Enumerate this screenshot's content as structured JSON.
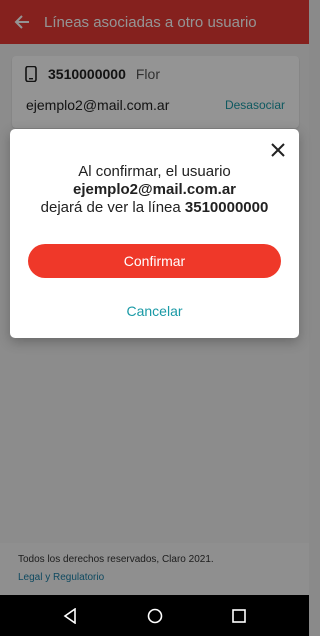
{
  "header": {
    "title": "Líneas asociadas a otro usuario"
  },
  "card": {
    "line_number": "3510000000",
    "line_name": "Flor",
    "email": "ejemplo2@mail.com.ar",
    "unlink_label": "Desasociar"
  },
  "dialog": {
    "line1": "Al confirmar, el usuario",
    "email": "ejemplo2@mail.com.ar",
    "line3_prefix": "dejará de ver la línea",
    "line_number": "3510000000",
    "confirm_label": "Confirmar",
    "cancel_label": "Cancelar"
  },
  "footer": {
    "rights": "Todos los derechos reservados, Claro 2021.",
    "legal_link": "Legal y Regulatorio"
  },
  "colors": {
    "brand_red": "#e53935",
    "button_red": "#ef3829",
    "link_teal": "#1a9aa6"
  },
  "icons": {
    "back": "arrow-back-icon",
    "phone": "smartphone-icon",
    "close": "close-icon"
  }
}
